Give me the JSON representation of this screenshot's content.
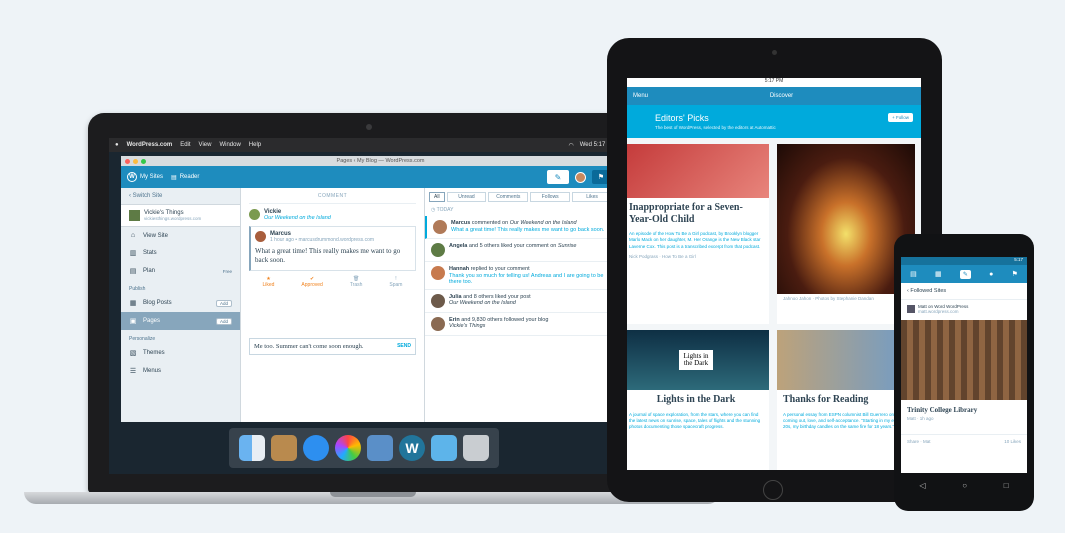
{
  "laptop": {
    "menubar": {
      "apple": "",
      "app": "WordPress.com",
      "menus": [
        "Edit",
        "View",
        "Window",
        "Help"
      ],
      "clock": "Wed 5:17 PM"
    },
    "window_title": "Pages ‹ My Blog — WordPress.com",
    "wp_bar": {
      "my_sites": "My Sites",
      "reader": "Reader",
      "write_icon": "✎",
      "notif_icon": "⚑"
    },
    "sidebar": {
      "switch": "‹ Switch Site",
      "site_name": "Vickie's Things",
      "site_url": "vickiesthings.wordpress.com",
      "items": [
        {
          "icon": "⌂",
          "label": "View Site",
          "badge": ""
        },
        {
          "icon": "▥",
          "label": "Stats",
          "badge": ""
        },
        {
          "icon": "▤",
          "label": "Plan",
          "badge": "Free"
        }
      ],
      "publish_head": "Publish",
      "publish_items": [
        {
          "icon": "▦",
          "label": "Blog Posts",
          "badge": "Add"
        },
        {
          "icon": "▣",
          "label": "Pages",
          "badge": "Add"
        }
      ],
      "personalize_head": "Personalize",
      "personalize_items": [
        {
          "icon": "▧",
          "label": "Themes"
        },
        {
          "icon": "☰",
          "label": "Menus"
        }
      ]
    },
    "comment": {
      "head": "COMMENT",
      "post_author": "Vickie",
      "post_link": "Our Weekend on the Island",
      "commenter": "Marcus",
      "meta": "1 hour ago • marcusdrummond.wordpress.com",
      "text": "What a great time! This really makes me want to go back soon.",
      "actions": [
        {
          "icon": "★",
          "label": "Liked"
        },
        {
          "icon": "✔",
          "label": "Approved"
        },
        {
          "icon": "🗑",
          "label": "Trash"
        },
        {
          "icon": "!",
          "label": "Spam"
        }
      ],
      "reply": "Me too. Summer can't come soon enough.",
      "send": "SEND"
    },
    "notifications": {
      "tabs": [
        "All",
        "Unread",
        "Comments",
        "Follows",
        "Likes"
      ],
      "day": "◷ TODAY",
      "items": [
        {
          "pre": "Marcus",
          "mid": " commented on ",
          "post": "Our Weekend on the Island",
          "sub": "What a great time! This really makes me want to go back soon."
        },
        {
          "pre": "Angela",
          "mid": " and 5 others liked your comment on ",
          "post": "Sunrise",
          "sub": ""
        },
        {
          "pre": "Hannah",
          "mid": " replied to your comment",
          "post": "",
          "sub": "Thank you so much for telling us! Andreas and I are going to be there too."
        },
        {
          "pre": "Julia",
          "mid": " and 8 others liked your post",
          "post": "",
          "sub": "Our Weekend on the Island"
        },
        {
          "pre": "Erin",
          "mid": " and 9,830 others followed your blog",
          "post": "",
          "sub": "Vickie's Things"
        }
      ]
    }
  },
  "tablet": {
    "time": "5:17 PM",
    "menu": "Menu",
    "discover": "Discover",
    "heading": "Editors' Picks",
    "subheading": "The best of WordPress, selected by the editors at Automattic",
    "follow": "+ Follow",
    "cards": [
      {
        "title": "Inappropriate for a Seven-Year-Old Child",
        "excerpt": "An episode of the How To Be a Girl podcast, by Brooklyn blogger Marlo Mack on her daughter, M. Her Orange is the New Black star Laverne Cox. This post is a transcribed excerpt from that podcast.",
        "meta": "Nick Podgrass · How To Be a Girl"
      },
      {
        "title": "",
        "excerpt": "",
        "meta": "Jahnoo Jahon · Photos by Stephanie Dandan"
      },
      {
        "title": "Lights in the Dark",
        "excerpt": "A journal of space exploration, from the stars, where you can find the latest news on sunrise, space, tales of flights and the stunning photos documenting those spacecraft progress.",
        "meta": ""
      },
      {
        "title": "Thanks for Reading",
        "excerpt": "A personal essay from ESPN columnist Bill Guerrero on coming out, love, and self-acceptance. \"Starting in my early 20s, my birthday candles on the same fire for 18 years.\"",
        "meta": ""
      }
    ],
    "album_text": "Lights in the Dark"
  },
  "phone": {
    "time": "5:17",
    "nav": [
      "▤",
      "▦",
      "✎",
      "●",
      "⚑"
    ],
    "back": "‹ Followed Sites",
    "site": "Matt on Word WordPress",
    "site_url": "matt.wordpress.com",
    "title": "Trinity College Library",
    "author": "Matt",
    "age": "1h ago",
    "foot_left": "Share · Mat",
    "foot_right": "10 Likes"
  }
}
